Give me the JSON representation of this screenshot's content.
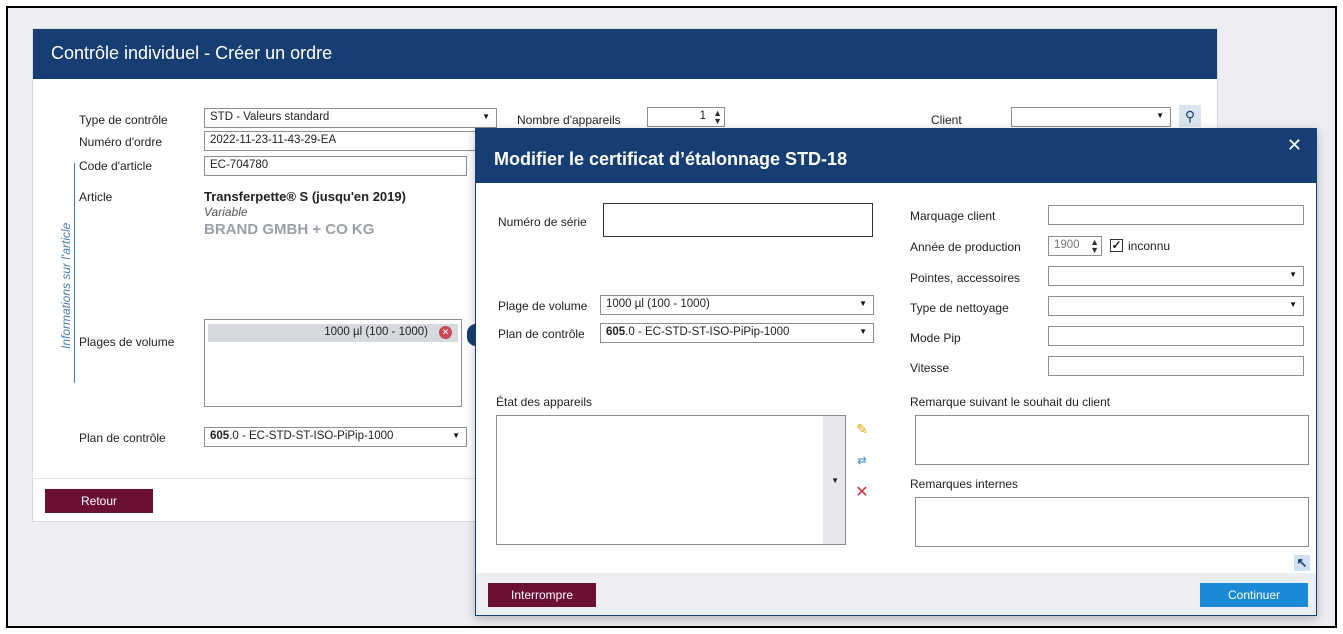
{
  "main": {
    "title": "Contrôle individuel - Créer un ordre",
    "type_controle_label": "Type de contrôle",
    "type_controle_value": "STD - Valeurs standard",
    "nb_appareils_label": "Nombre d'appareils",
    "nb_appareils_value": "1",
    "client_label": "Client",
    "client_value": "",
    "numero_ordre_label": "Numéro d'ordre",
    "numero_ordre_value": "2022-11-23-11-43-29-EA",
    "code_article_label": "Code d'article",
    "code_article_value": "EC-704780",
    "article_label": "Article",
    "article_name": "Transferpette® S (jusqu'en 2019)",
    "article_variant": "Variable",
    "article_maker": "BRAND GMBH + CO KG",
    "side_section_label": "Informations sur l'article",
    "plages_label": "Plages de volume",
    "plages_items": [
      "1000 µl (100 - 1000)"
    ],
    "plan_label": "Plan de contrôle",
    "plan_value_bold": "605",
    "plan_value_rest": ".0 - EC-STD-ST-ISO-PiPip-1000",
    "retour_button": "Retour"
  },
  "dialog": {
    "title": "Modifier le certificat d’étalonnage STD-18",
    "serie_label": "Numéro de série",
    "serie_value": "",
    "plage_label": "Plage de volume",
    "plage_value": "1000 µl (100 - 1000)",
    "plan_label": "Plan de contrôle",
    "plan_value_bold": "605",
    "plan_value_rest": ".0 - EC-STD-ST-ISO-PiPip-1000",
    "etat_label": "État des appareils",
    "marquage_label": "Marquage client",
    "annee_label": "Année de production",
    "annee_value": "1900",
    "inconnu_label": "inconnu",
    "inconnu_checked": true,
    "pointes_label": "Pointes, accessoires",
    "nettoyage_label": "Type de nettoyage",
    "mode_pip_label": "Mode Pip",
    "vitesse_label": "Vitesse",
    "remarque_client_label": "Remarque suivant le souhait du client",
    "remarques_internes_label": "Remarques internes",
    "interrompre_button": "Interrompre",
    "continuer_button": "Continuer"
  },
  "colors": {
    "header": "#173e73",
    "danger_button": "#6b0f33",
    "primary_button": "#1b8ad6"
  }
}
